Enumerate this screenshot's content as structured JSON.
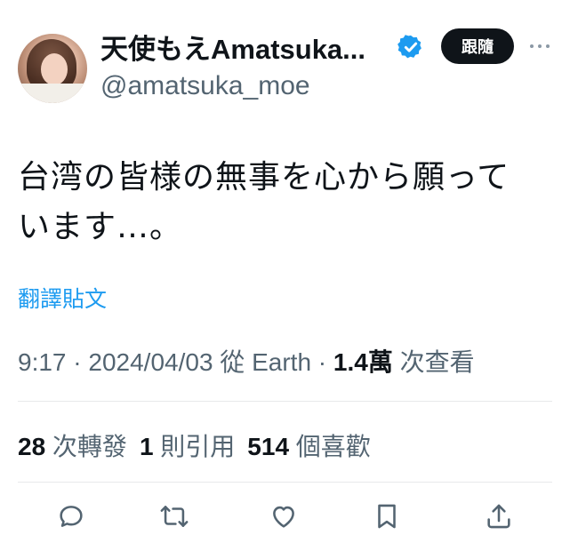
{
  "author": {
    "display_name": "天使もえAmatsuka...",
    "handle": "@amatsuka_moe",
    "verified_color": "#1d9bf0"
  },
  "follow_button": {
    "label": "跟隨"
  },
  "tweet": {
    "text_line1": "台湾の皆様の無事を心から願って",
    "text_line2": "います…。",
    "translate_label": "翻譯貼文"
  },
  "meta": {
    "time": "9:17",
    "separator": " · ",
    "date": "2024/04/03",
    "source_prefix": " 從 ",
    "source": "Earth",
    "views_count": "1.4萬",
    "views_label": " 次查看"
  },
  "stats": {
    "retweets_count": "28",
    "retweets_label": " 次轉發",
    "quotes_count": "1",
    "quotes_label": " 則引用",
    "likes_count": "514",
    "likes_label": " 個喜歡"
  },
  "actions": [
    "reply-icon",
    "retweet-icon",
    "like-icon",
    "bookmark-icon",
    "share-icon"
  ],
  "colors": {
    "text": "#0f1419",
    "secondary": "#536471",
    "accent": "#1d9bf0",
    "divider": "#e7e9ea"
  }
}
